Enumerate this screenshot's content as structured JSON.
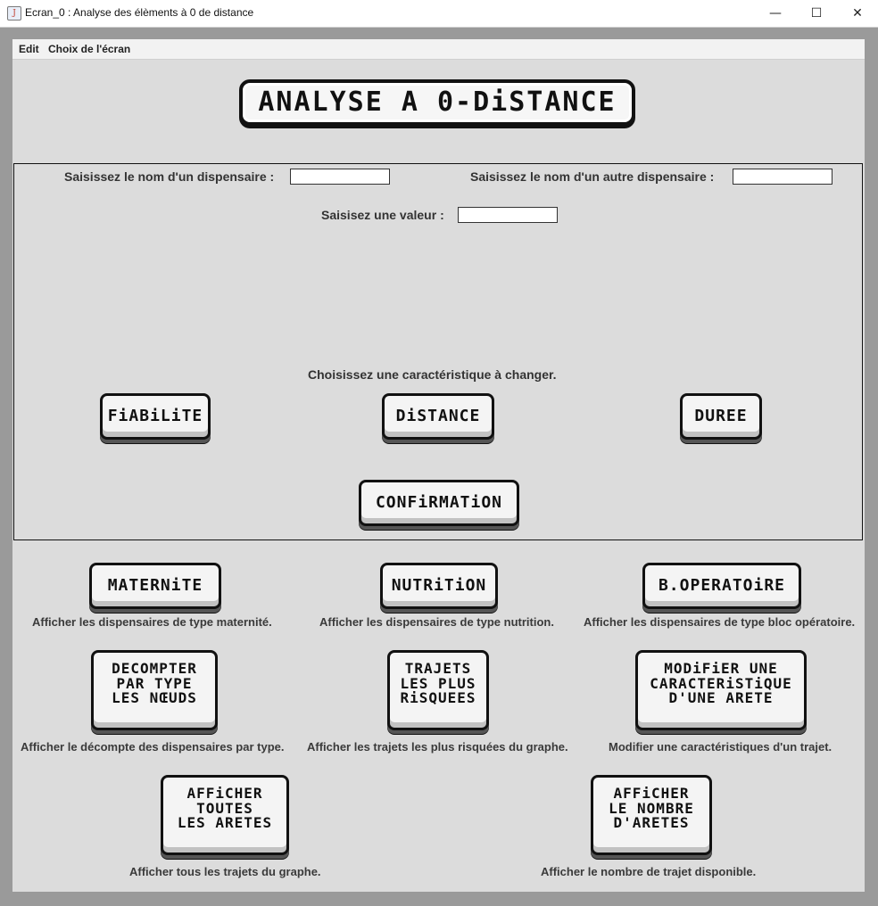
{
  "window": {
    "title": "Ecran_0 : Analyse des élèments à 0 de distance",
    "app_icon": "java-icon",
    "minimize": "—",
    "maximize": "☐",
    "close": "✕"
  },
  "menu": {
    "items": [
      "Edit",
      "Choix de l'écran"
    ]
  },
  "header": {
    "title": "ANALYSE A 0-DiSTANCE"
  },
  "form": {
    "dispensaire1_label": "Saisissez le nom d'un dispensaire :",
    "dispensaire1_value": "",
    "dispensaire2_label": "Saisissez le nom d'un autre dispensaire :",
    "dispensaire2_value": "",
    "valeur_label": "Saisisez une valeur :",
    "valeur_value": "",
    "choose_label": "Choisissez une caractéristique à changer."
  },
  "characteristics": {
    "fiabilite": "FiABiLiTE",
    "distance": "DiSTANCE",
    "duree": "DUREE"
  },
  "confirm": "CONFiRMATiON",
  "actions": [
    {
      "button": "MATERNiTE",
      "desc": "Afficher les dispensaires de type maternité."
    },
    {
      "button": "NUTRiTiON",
      "desc": "Afficher les dispensaires de type nutrition."
    },
    {
      "button": "B.OPERATOiRE",
      "desc": "Afficher les dispensaires de type bloc opératoire."
    },
    {
      "button": "DECOMPTER\nPAR TYPE\nLES NŒUDS",
      "desc": "Afficher le décompte des dispensaires par type."
    },
    {
      "button": "TRAJETS\nLES PLUS\nRiSQUEES",
      "desc": "Afficher les trajets les plus risquées du graphe."
    },
    {
      "button": "MODiFiER UNE\nCARACTERiSTiQUE\nD'UNE ARETE",
      "desc": "Modifier une caractéristiques d'un trajet."
    },
    {
      "button": "AFFiCHER\nTOUTES\nLES ARETES",
      "desc": "Afficher tous les trajets du graphe."
    },
    {
      "button": "AFFiCHER\nLE NOMBRE\nD'ARETES",
      "desc": "Afficher le nombre de trajet disponible."
    }
  ]
}
